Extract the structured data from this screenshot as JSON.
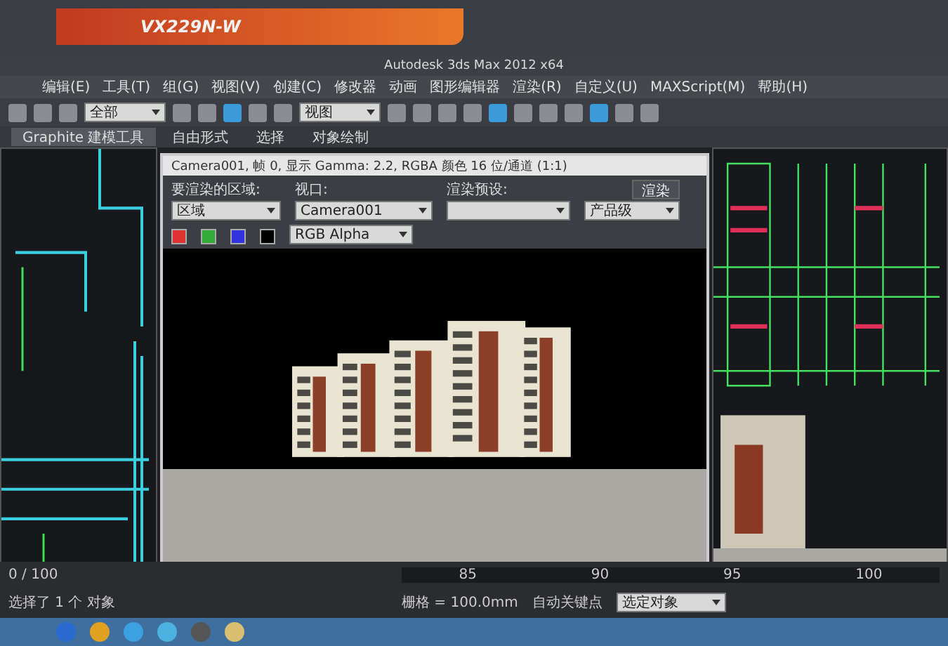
{
  "monitor": {
    "model": "VX229N-W"
  },
  "window": {
    "title": "Autodesk 3ds Max 2012 x64"
  },
  "menu": [
    "编辑(E)",
    "工具(T)",
    "组(G)",
    "视图(V)",
    "创建(C)",
    "修改器",
    "动画",
    "图形编辑器",
    "渲染(R)",
    "自定义(U)",
    "MAXScript(M)",
    "帮助(H)"
  ],
  "toolbar": {
    "selection_filter": "全部",
    "coordinate_system": "视图"
  },
  "ribbon_tabs": [
    {
      "label": "Graphite 建模工具",
      "selected": true
    },
    {
      "label": "自由形式",
      "selected": false
    },
    {
      "label": "选择",
      "selected": false
    },
    {
      "label": "对象绘制",
      "selected": false
    }
  ],
  "render_window": {
    "title": "Camera001, 帧 0, 显示 Gamma: 2.2, RGBA 颜色 16 位/通道 (1:1)",
    "area_label": "要渲染的区域:",
    "area_value": "区域",
    "viewport_label": "视口:",
    "viewport_value": "Camera001",
    "preset_label": "渲染预设:",
    "render_button": "渲染",
    "render_mode": "产品级",
    "channel_value": "RGB Alpha"
  },
  "status": {
    "selection": "选择了 1 个 对象",
    "frame": "0 / 100",
    "grid": "栅格 = 100.0mm",
    "auto_key": "自动关键点",
    "key_filter": "选定对象",
    "ticks": [
      "85",
      "90",
      "95",
      "100"
    ]
  }
}
